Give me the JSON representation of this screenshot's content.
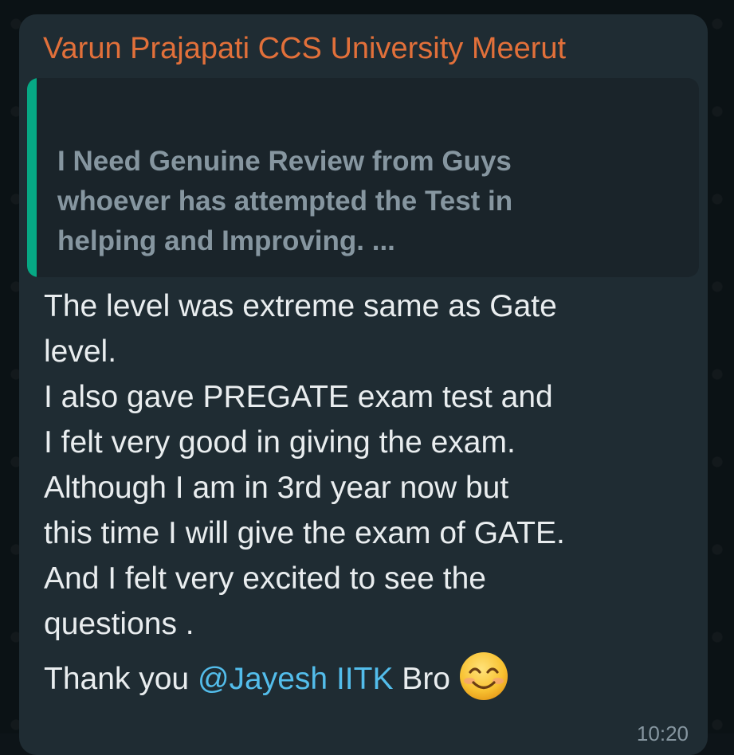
{
  "message": {
    "sender": "Varun Prajapati CCS University Meerut",
    "quoted": {
      "lines": [
        "I Need Genuine Review from Guys",
        "whoever has attempted the Test in",
        "helping and Improving. ..."
      ]
    },
    "body_lines": [
      "The level was extreme same as Gate",
      "level.",
      "I also gave PREGATE exam test and",
      "I felt very good in giving the exam.",
      "Although I am in 3rd year now but",
      "this time I will give the exam of GATE.",
      "And I felt very excited to see the",
      "questions ."
    ],
    "thanks_prefix": "Thank you ",
    "mention": "@Jayesh IITK",
    "thanks_suffix": "  Bro",
    "emoji_icon": "smiling-face-emoji",
    "timestamp": "10:20"
  },
  "colors": {
    "sender": "#e2703a",
    "quote_bar": "#06a884",
    "mention": "#53bdeb",
    "bubble": "#1f2c33"
  }
}
